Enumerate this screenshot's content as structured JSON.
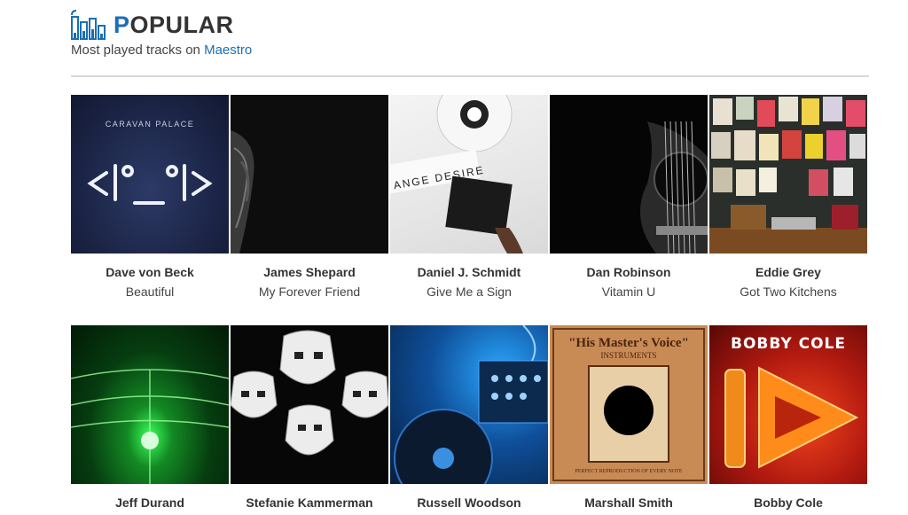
{
  "header": {
    "title_first_letter": "P",
    "title_rest": "OPULAR",
    "subtitle_prefix": "Most played tracks on ",
    "subtitle_link": "Maestro"
  },
  "colors": {
    "accent": "#1a6fb5",
    "divider": "#d8d8d8"
  },
  "tracks": [
    {
      "artist": "Dave von Beck",
      "track": "Beautiful",
      "cover_icon": "caravan-palace-robot-face",
      "cover_text": "CARAVAN PALACE"
    },
    {
      "artist": "James Shepard",
      "track": "My Forever Friend",
      "cover_icon": "dark-cello"
    },
    {
      "artist": "Daniel J. Schmidt",
      "track": "Give Me a Sign",
      "cover_icon": "vinyl-record-white",
      "cover_text": "ANGE DESIRE"
    },
    {
      "artist": "Dan Robinson",
      "track": "Vitamin U",
      "cover_icon": "acoustic-guitar"
    },
    {
      "artist": "Eddie Grey",
      "track": "Got Two Kitchens",
      "cover_icon": "poster-wall-turntable"
    },
    {
      "artist": "Jeff Durand",
      "track": "",
      "cover_icon": "green-light-burst"
    },
    {
      "artist": "Stefanie Kammerman",
      "track": "",
      "cover_icon": "stormtrooper-helmets"
    },
    {
      "artist": "Russell Woodson",
      "track": "",
      "cover_icon": "dj-turntable-blue"
    },
    {
      "artist": "Marshall Smith",
      "track": "",
      "cover_icon": "his-masters-voice",
      "cover_text": "\"His Master's Voice\"",
      "cover_text2": "INSTRUMENTS",
      "cover_text3": "PERFECT REPRODUCTION OF EVERY NOTE"
    },
    {
      "artist": "Bobby Cole",
      "track": "",
      "cover_icon": "play-arrow-red",
      "cover_text": "BOBBY COLE"
    }
  ]
}
